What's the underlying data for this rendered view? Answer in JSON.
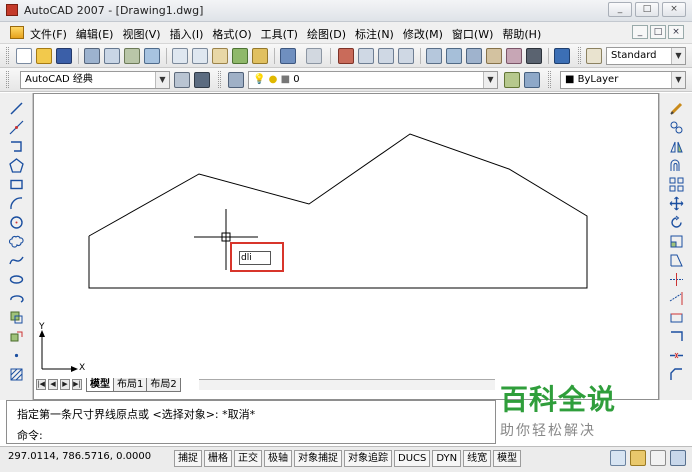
{
  "titlebar": {
    "title": "AutoCAD 2007 - [Drawing1.dwg]",
    "controls": [
      "_",
      "□",
      "×"
    ]
  },
  "menubar": {
    "items": [
      "文件(F)",
      "编辑(E)",
      "视图(V)",
      "插入(I)",
      "格式(O)",
      "工具(T)",
      "绘图(D)",
      "标注(N)",
      "修改(M)",
      "窗口(W)",
      "帮助(H)"
    ],
    "mdi_controls": [
      "_",
      "□",
      "×"
    ]
  },
  "toolbar": {
    "text_style": "Standard",
    "workspace": "AutoCAD 经典",
    "layer": "0",
    "color": "ByLayer"
  },
  "layout_tabs": [
    "模型",
    "布局1",
    "布局2"
  ],
  "ucs": {
    "x_label": "X",
    "y_label": "Y"
  },
  "dynamic_input": {
    "value": "dli"
  },
  "command_area": {
    "history": "指定第一条尺寸界线原点或 <选择对象>: *取消*",
    "prompt": "命令:"
  },
  "watermark": {
    "brand": "百科全说",
    "slogan": "助你轻松解决"
  },
  "statusbar": {
    "coordinates": "297.0114, 786.5716, 0.0000",
    "toggles": [
      "捕捉",
      "栅格",
      "正交",
      "极轴",
      "对象捕捉",
      "对象追踪",
      "DUCS",
      "DYN",
      "线宽",
      "模型"
    ]
  },
  "colors": {
    "highlight": "#d8352b",
    "watermark_green": "#2f9e3b",
    "drawing_line": "#000000"
  }
}
